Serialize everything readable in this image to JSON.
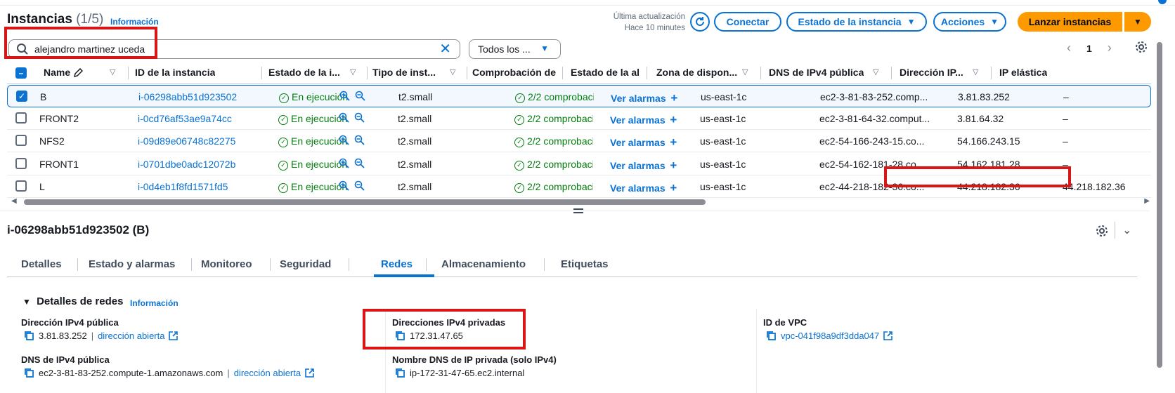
{
  "header": {
    "title": "Instancias",
    "count": "(1/5)",
    "info_link": "Información",
    "last_update_label": "Última actualización",
    "last_update_value": "Hace 10 minutes",
    "connect_label": "Conectar",
    "instance_state_label": "Estado de la instancia",
    "actions_label": "Acciones",
    "launch_label": "Lanzar instancias"
  },
  "search": {
    "value": "alejandro martinez uceda",
    "filter_value": "Todos los ..."
  },
  "pagination": {
    "page": "1"
  },
  "table": {
    "columns": [
      "Name",
      "ID de la instancia",
      "Estado de la i...",
      "Tipo de inst...",
      "Comprobación de",
      "Estado de la al",
      "Zona de dispon...",
      "DNS de IPv4 pública",
      "Dirección IP...",
      "IP elástica"
    ],
    "rows": [
      {
        "name": "B",
        "id": "i-06298abb51d923502",
        "state": "En ejecución",
        "type": "t2.small",
        "check": "2/2 comprobacior",
        "alarm": "Ver alarmas",
        "zone": "us-east-1c",
        "dns": "ec2-3-81-83-252.comp...",
        "ip": "3.81.83.252",
        "eip": "–"
      },
      {
        "name": "FRONT2",
        "id": "i-0cd76af53ae9a74cc",
        "state": "En ejecución",
        "type": "t2.small",
        "check": "2/2 comprobacior",
        "alarm": "Ver alarmas",
        "zone": "us-east-1c",
        "dns": "ec2-3-81-64-32.comput...",
        "ip": "3.81.64.32",
        "eip": "–"
      },
      {
        "name": "NFS2",
        "id": "i-09d89e06748c82275",
        "state": "En ejecución",
        "type": "t2.small",
        "check": "2/2 comprobacior",
        "alarm": "Ver alarmas",
        "zone": "us-east-1c",
        "dns": "ec2-54-166-243-15.co...",
        "ip": "54.166.243.15",
        "eip": "–"
      },
      {
        "name": "FRONT1",
        "id": "i-0701dbe0adc12072b",
        "state": "En ejecución",
        "type": "t2.small",
        "check": "2/2 comprobacior",
        "alarm": "Ver alarmas",
        "zone": "us-east-1c",
        "dns": "ec2-54-162-181-28.co...",
        "ip": "54.162.181.28",
        "eip": "–"
      },
      {
        "name": "L",
        "id": "i-0d4eb1f8fd1571fd5",
        "state": "En ejecución",
        "type": "t2.small",
        "check": "2/2 comprobacior",
        "alarm": "Ver alarmas",
        "zone": "us-east-1c",
        "dns": "ec2-44-218-182-36.co...",
        "ip": "44.218.182.36",
        "eip": "44.218.182.36"
      }
    ]
  },
  "detail": {
    "title": "i-06298abb51d923502 (B)",
    "tabs": [
      "Detalles",
      "Estado y alarmas",
      "Monitoreo",
      "Seguridad",
      "Redes",
      "Almacenamiento",
      "Etiquetas"
    ],
    "active_tab": "Redes",
    "section_title": "Detalles de redes",
    "section_info": "Información",
    "public_ipv4_label": "Dirección IPv4 pública",
    "public_ipv4_value": "3.81.83.252",
    "open_address_label": "dirección abierta",
    "private_ipv4_label": "Direcciones IPv4 privadas",
    "private_ipv4_value": "172.31.47.65",
    "vpc_label": "ID de VPC",
    "vpc_value": "vpc-041f98a9df3dda047",
    "public_dns_label": "DNS de IPv4 pública",
    "public_dns_value": "ec2-3-81-83-252.compute-1.amazonaws.com",
    "private_dns_label": "Nombre DNS de IP privada (solo IPv4)",
    "private_dns_value": "ip-172-31-47-65.ec2.internal"
  },
  "colors": {
    "accent": "#0972d3",
    "launch": "#ff9900",
    "success": "#037f0c",
    "highlight": "#d91515"
  },
  "icons": [
    "search-icon",
    "clear-icon",
    "refresh-icon",
    "settings-icon",
    "check-circle-icon",
    "zoom-in-icon",
    "zoom-out-icon",
    "plus-icon",
    "copy-icon",
    "external-link-icon",
    "chevron-down-icon",
    "edit-icon"
  ]
}
